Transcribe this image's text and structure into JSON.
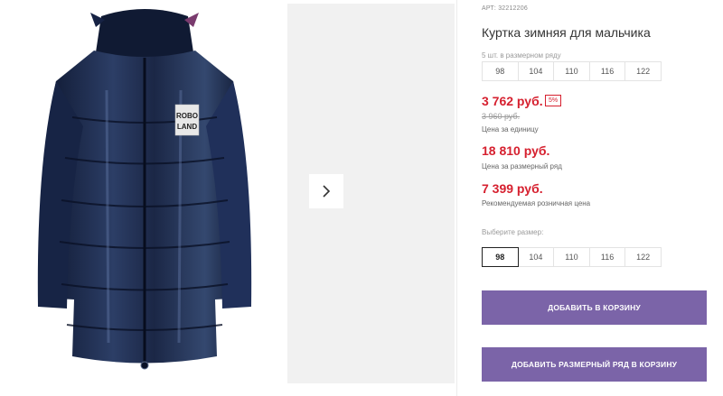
{
  "product": {
    "sku": "АРТ: 32212206",
    "title": "Куртка зимняя для мальчика",
    "range_label": "5 шт. в размерном ряду",
    "range_sizes": [
      "98",
      "104",
      "110",
      "116",
      "122"
    ],
    "price": "3 762 руб.",
    "discount_badge": "5%",
    "old_price": "3 960 руб.",
    "price_caption": "Цена за единицу",
    "range_price": "18 810 руб.",
    "range_price_caption": "Цена за размерный ряд",
    "retail_price": "7 399 руб.",
    "retail_caption": "Рекомендуемая розничная цена",
    "choose_label": "Выберите размер:",
    "choose_sizes": [
      "98",
      "104",
      "110",
      "116",
      "122"
    ],
    "selected_size": "98",
    "add_to_cart": "ДОБАВИТЬ В КОРЗИНУ",
    "add_range_to_cart": "ДОБАВИТЬ РАЗМЕРНЫЙ РЯД В КОРЗИНУ"
  },
  "jacket_patch": [
    "ROBO",
    "LAND"
  ],
  "icons": {
    "next": "chevron-right-icon"
  },
  "colors": {
    "price": "#d6202f",
    "button": "#7b64a8",
    "jacket": "#1e2a45"
  }
}
